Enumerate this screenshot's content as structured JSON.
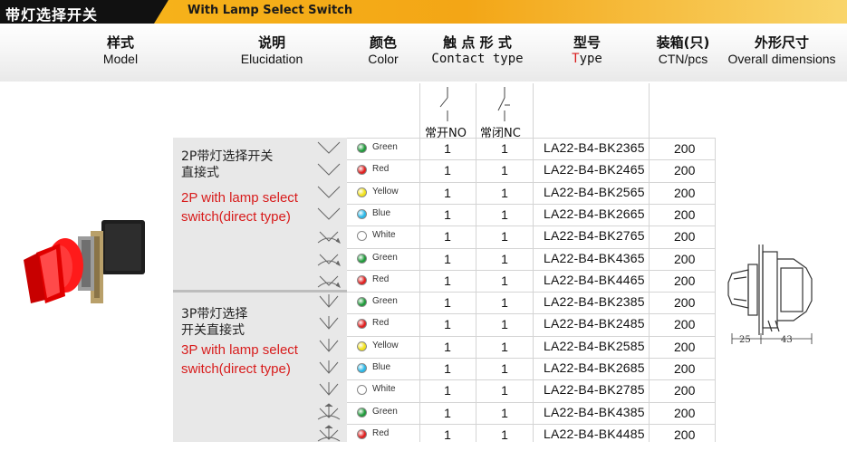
{
  "title_bar": {
    "cn": "带灯选择开关",
    "en": "With Lamp Select Switch"
  },
  "headers": {
    "model": {
      "cn": "样式",
      "en": "Model"
    },
    "elucidation": {
      "cn": "说明",
      "en": "Elucidation"
    },
    "color": {
      "cn": "颜色",
      "en": "Color"
    },
    "contact": {
      "cn": "触 点 形 式",
      "en": "Contact  type"
    },
    "type": {
      "cn": "型号",
      "en_first": "T",
      "en_rest": "ype"
    },
    "ctn": {
      "cn": "装箱(只)",
      "en": "CTN/pcs"
    },
    "dims": {
      "cn": "外形尺寸",
      "en": "Overall dimensions"
    }
  },
  "contact_labels": {
    "no": "常开NO",
    "nc": "常闭NC"
  },
  "groups": [
    {
      "cn_line1": "2P带灯选择开关",
      "cn_line2": "直接式",
      "en_line1": "2P with lamp select",
      "en_line2": "switch(direct type)"
    },
    {
      "cn_line1": "3P带灯选择",
      "cn_line2": "开关直接式",
      "en_line1": "3P with lamp select",
      "en_line2": "switch(direct type)"
    }
  ],
  "dimensions": {
    "a": "25",
    "b": "43"
  },
  "rows": [
    {
      "color": "Green",
      "dot": "#1f9a3a",
      "no": "1",
      "nc": "1",
      "model": "LA22-B4-BK2365",
      "ctn": "200",
      "symbol": "2pos"
    },
    {
      "color": "Red",
      "dot": "#e02020",
      "no": "1",
      "nc": "1",
      "model": "LA22-B4-BK2465",
      "ctn": "200",
      "symbol": "2pos"
    },
    {
      "color": "Yellow",
      "dot": "#f2e21a",
      "no": "1",
      "nc": "1",
      "model": "LA22-B4-BK2565",
      "ctn": "200",
      "symbol": "2pos"
    },
    {
      "color": "Blue",
      "dot": "#29b8e8",
      "no": "1",
      "nc": "1",
      "model": "LA22-B4-BK2665",
      "ctn": "200",
      "symbol": "2pos"
    },
    {
      "color": "White",
      "dot": "#ffffff",
      "no": "1",
      "nc": "1",
      "model": "LA22-B4-BK2765",
      "ctn": "200",
      "symbol": "2ret"
    },
    {
      "color": "Green",
      "dot": "#1f9a3a",
      "no": "1",
      "nc": "1",
      "model": "LA22-B4-BK4365",
      "ctn": "200",
      "symbol": "2ret"
    },
    {
      "color": "Red",
      "dot": "#e02020",
      "no": "1",
      "nc": "1",
      "model": "LA22-B4-BK4465",
      "ctn": "200",
      "symbol": "2ret"
    },
    {
      "color": "Green",
      "dot": "#1f9a3a",
      "no": "1",
      "nc": "1",
      "model": "LA22-B4-BK2385",
      "ctn": "200",
      "symbol": "3pos"
    },
    {
      "color": "Red",
      "dot": "#e02020",
      "no": "1",
      "nc": "1",
      "model": "LA22-B4-BK2485",
      "ctn": "200",
      "symbol": "3pos"
    },
    {
      "color": "Yellow",
      "dot": "#f2e21a",
      "no": "1",
      "nc": "1",
      "model": "LA22-B4-BK2585",
      "ctn": "200",
      "symbol": "3pos"
    },
    {
      "color": "Blue",
      "dot": "#29b8e8",
      "no": "1",
      "nc": "1",
      "model": "LA22-B4-BK2685",
      "ctn": "200",
      "symbol": "3pos"
    },
    {
      "color": "White",
      "dot": "#ffffff",
      "no": "1",
      "nc": "1",
      "model": "LA22-B4-BK2785",
      "ctn": "200",
      "symbol": "3pos"
    },
    {
      "color": "Green",
      "dot": "#1f9a3a",
      "no": "1",
      "nc": "1",
      "model": "LA22-B4-BK4385",
      "ctn": "200",
      "symbol": "3ret"
    },
    {
      "color": "Red",
      "dot": "#e02020",
      "no": "1",
      "nc": "1",
      "model": "LA22-B4-BK4485",
      "ctn": "200",
      "symbol": "3ret"
    }
  ]
}
